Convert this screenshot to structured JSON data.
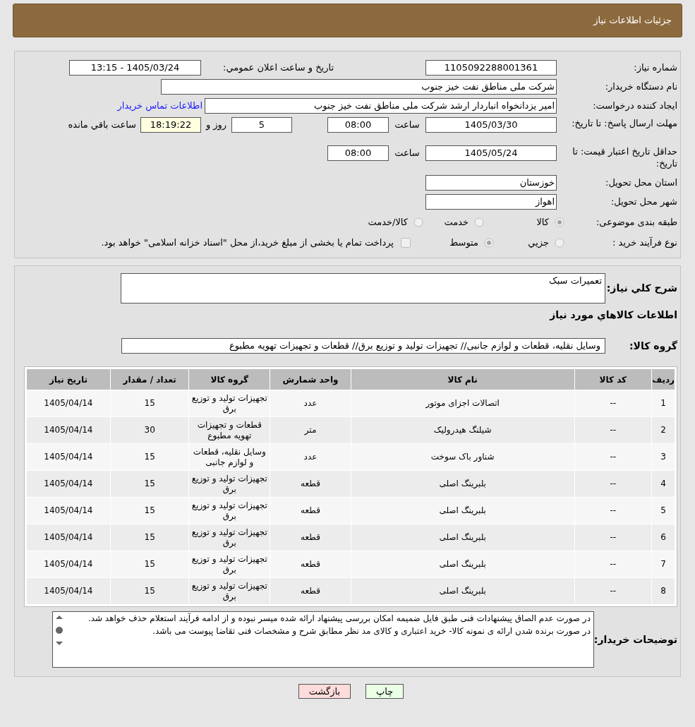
{
  "header": {
    "title": "جزئیات اطلاعات نیاز"
  },
  "need_number": {
    "label": "شماره نیاز:",
    "value": "1105092288001361"
  },
  "announce": {
    "label": "تاريخ و ساعت اعلان عمومي:",
    "value": "1405/03/24 - 13:15"
  },
  "buyer_org": {
    "label": "نام دستگاه خریدار:",
    "value": "شرکت ملی مناطق نفت خیز جنوب"
  },
  "requester": {
    "label": "ایجاد کننده درخواست:",
    "value": "امیر یزدانخواه انباردار ارشد شرکت ملی مناطق نفت خیز جنوب",
    "link": "اطلاعات تماس خریدار"
  },
  "reply_deadline": {
    "label": "مهلت ارسال پاسخ: تا تاریخ:",
    "date": "1405/03/30",
    "time_label": "ساعت",
    "time": "08:00",
    "days": "5",
    "days_label": "روز و",
    "remaining": "18:19:22",
    "remaining_label": "ساعت باقي مانده"
  },
  "price_validity": {
    "label": "حداقل تاریخ اعتبار قیمت: تا تاریخ:",
    "date": "1405/05/24",
    "time_label": "ساعت",
    "time": "08:00"
  },
  "province": {
    "label": "استان محل تحویل:",
    "value": "خوزستان"
  },
  "city": {
    "label": "شهر محل تحویل:",
    "value": "اهواز"
  },
  "category": {
    "label": "طبقه بندی موضوعی:",
    "options": [
      {
        "label": "کالا",
        "selected": true
      },
      {
        "label": "خدمت",
        "selected": false
      },
      {
        "label": "کالا/خدمت",
        "selected": false
      }
    ]
  },
  "process": {
    "label": "نوع فرآیند خرید :",
    "options": [
      {
        "label": "جزيي",
        "selected": false
      },
      {
        "label": "متوسط",
        "selected": true
      }
    ],
    "treasury": {
      "label": "پرداخت تمام یا بخشی از مبلغ خرید،از محل \"اسناد خزانه اسلامی\" خواهد بود.",
      "checked": false
    }
  },
  "description": {
    "label": "شرح كلي نياز:",
    "value": "تعميرات سبک"
  },
  "items_heading": "اطلاعات كالاهاي مورد نياز",
  "goods_group": {
    "label": "گروه کالا:",
    "value": "وسایل نقلیه، قطعات و لوازم جانبی// تجهیزات تولید و توزیع برق//  قطعات و تجهیزات تهویه مطبوع"
  },
  "table": {
    "columns": [
      "ردیف",
      "کد کالا",
      "نام کالا",
      "واحد شمارش",
      "گروه کالا",
      "تعداد / مقدار",
      "تاریخ نیاز"
    ],
    "rows": [
      [
        "1",
        "--",
        "اتصالات اجزای موتور",
        "عدد",
        "تجهیزات تولید و توزیع برق",
        "15",
        "1405/04/14"
      ],
      [
        "2",
        "--",
        "شیلنگ هیدرولیک",
        "متر",
        "قطعات و تجهیزات تهویه مطبوع",
        "30",
        "1405/04/14"
      ],
      [
        "3",
        "--",
        "شناور باک سوخت",
        "عدد",
        "وسایل نقلیه، قطعات و لوازم جانبی",
        "15",
        "1405/04/14"
      ],
      [
        "4",
        "--",
        "بلبرینگ اصلی",
        "قطعه",
        "تجهیزات تولید و توزیع برق",
        "15",
        "1405/04/14"
      ],
      [
        "5",
        "--",
        "بلبرینگ اصلی",
        "قطعه",
        "تجهیزات تولید و توزیع برق",
        "15",
        "1405/04/14"
      ],
      [
        "6",
        "--",
        "بلبرینگ اصلی",
        "قطعه",
        "تجهیزات تولید و توزیع برق",
        "15",
        "1405/04/14"
      ],
      [
        "7",
        "--",
        "بلبرینگ اصلی",
        "قطعه",
        "تجهیزات تولید و توزیع برق",
        "15",
        "1405/04/14"
      ],
      [
        "8",
        "--",
        "بلبرینگ اصلی",
        "قطعه",
        "تجهیزات تولید و توزیع برق",
        "15",
        "1405/04/14"
      ]
    ]
  },
  "buyer_notes": {
    "label": "توضیحات خریدار:",
    "value": "در صورت عدم الصاق پیشنهادات فنی طبق فایل ضمیمه امکان بررسی پیشنهاد ارائه شده میسر نبوده و از ادامه فرآیند استعلام حذف خواهد شد.\nدر صورت برنده شدن ارائه ی نمونه کالا- خرید اعتباری و کالای مد نظر مطابق شرح و مشخصات فنی تقاضا پیوست می باشد."
  },
  "buttons": [
    {
      "label": "چاپ",
      "kind": "print"
    },
    {
      "label": "بازگشت",
      "kind": "back"
    }
  ]
}
